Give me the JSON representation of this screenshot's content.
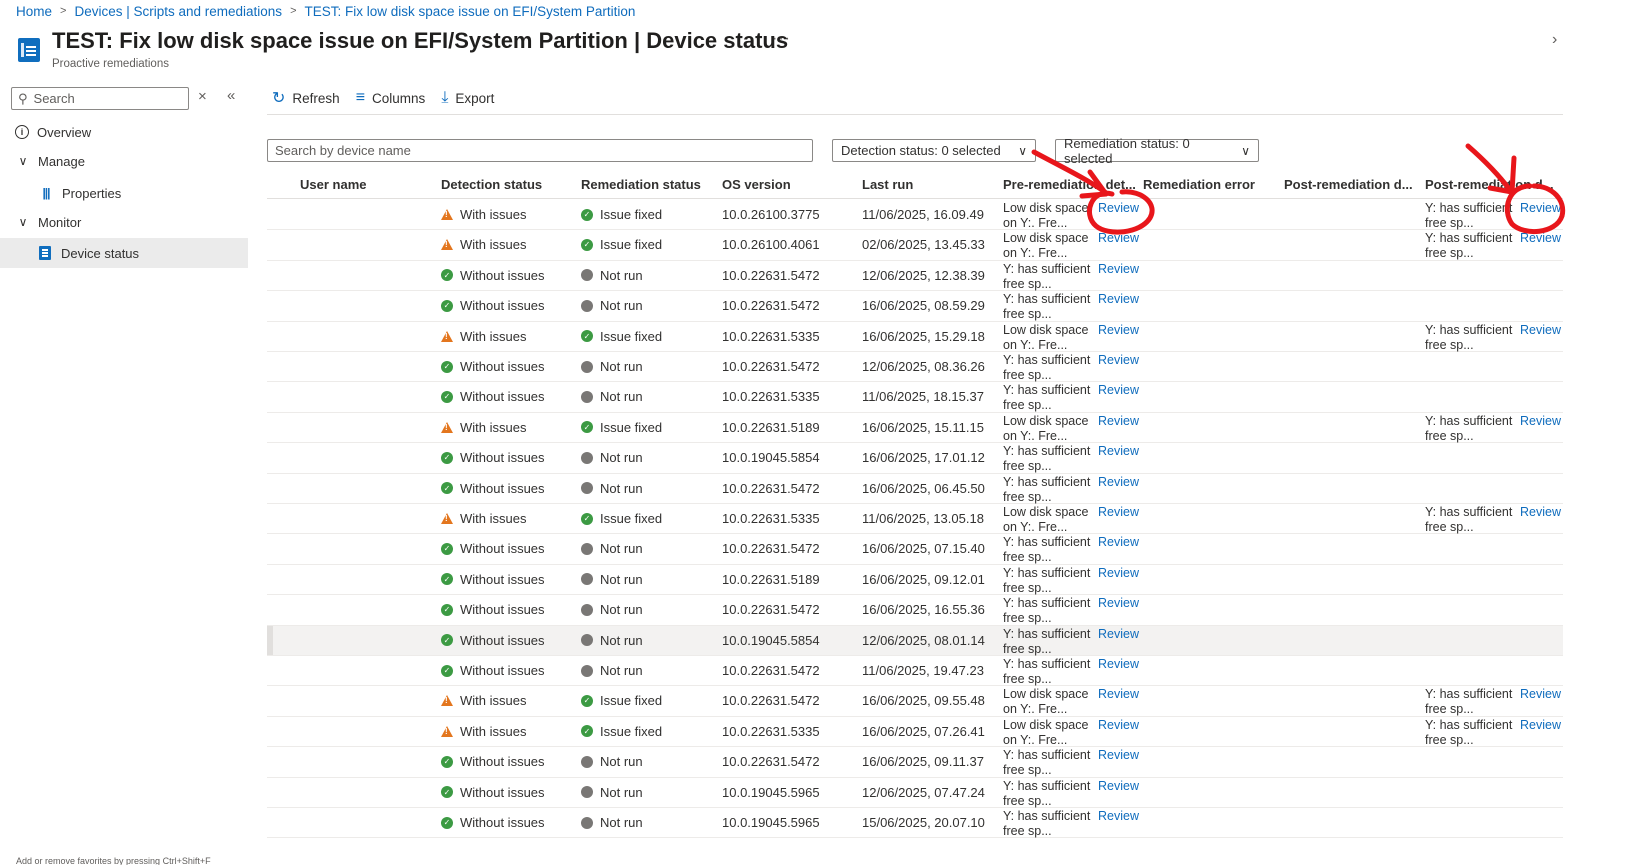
{
  "breadcrumb": {
    "items": [
      "Home",
      "Devices | Scripts and remediations",
      "TEST: Fix low disk space issue on EFI/System Partition"
    ]
  },
  "header": {
    "title": "TEST: Fix low disk space issue on EFI/System Partition",
    "title_suffix": "| Device status",
    "subtitle": "Proactive remediations",
    "more": "···",
    "chevron": "›"
  },
  "sidebar": {
    "search_placeholder": "Search",
    "close": "×",
    "collapse": "«",
    "items": [
      {
        "label": "Overview"
      },
      {
        "label": "Manage"
      },
      {
        "label": "Properties"
      },
      {
        "label": "Monitor"
      },
      {
        "label": "Device status"
      }
    ],
    "footer": "Add or remove favorites by pressing Ctrl+Shift+F"
  },
  "toolbar": {
    "refresh": "Refresh",
    "columns": "Columns",
    "export": "Export"
  },
  "filters": {
    "device_search_placeholder": "Search by device name",
    "detection": "Detection status: 0 selected",
    "remediation": "Remediation status: 0 selected"
  },
  "table": {
    "columns": [
      "User name",
      "Detection status",
      "Remediation status",
      "OS version",
      "Last run",
      "Pre-remediation det...",
      "Remediation error",
      "Post-remediation d...",
      "Post-remediation d..."
    ],
    "review_label": "Review",
    "rows": [
      {
        "det": "With issues",
        "det_type": "warn",
        "rem": "Issue fixed",
        "rem_type": "ok",
        "os": "10.0.26100.3775",
        "last": "11/06/2025, 16.09.49",
        "pre": "Low disk space on Y:. Fre...",
        "post": "Y: has sufficient free sp..."
      },
      {
        "det": "With issues",
        "det_type": "warn",
        "rem": "Issue fixed",
        "rem_type": "ok",
        "os": "10.0.26100.4061",
        "last": "02/06/2025, 13.45.33",
        "pre": "Low disk space on Y:. Fre...",
        "post": "Y: has sufficient free sp..."
      },
      {
        "det": "Without issues",
        "det_type": "ok",
        "rem": "Not run",
        "rem_type": "gray",
        "os": "10.0.22631.5472",
        "last": "12/06/2025, 12.38.39",
        "pre": "Y: has sufficient free sp...",
        "post": ""
      },
      {
        "det": "Without issues",
        "det_type": "ok",
        "rem": "Not run",
        "rem_type": "gray",
        "os": "10.0.22631.5472",
        "last": "16/06/2025, 08.59.29",
        "pre": "Y: has sufficient free sp...",
        "post": ""
      },
      {
        "det": "With issues",
        "det_type": "warn",
        "rem": "Issue fixed",
        "rem_type": "ok",
        "os": "10.0.22631.5335",
        "last": "16/06/2025, 15.29.18",
        "pre": "Low disk space on Y:. Fre...",
        "post": "Y: has sufficient free sp..."
      },
      {
        "det": "Without issues",
        "det_type": "ok",
        "rem": "Not run",
        "rem_type": "gray",
        "os": "10.0.22631.5472",
        "last": "12/06/2025, 08.36.26",
        "pre": "Y: has sufficient free sp...",
        "post": ""
      },
      {
        "det": "Without issues",
        "det_type": "ok",
        "rem": "Not run",
        "rem_type": "gray",
        "os": "10.0.22631.5335",
        "last": "11/06/2025, 18.15.37",
        "pre": "Y: has sufficient free sp...",
        "post": ""
      },
      {
        "det": "With issues",
        "det_type": "warn",
        "rem": "Issue fixed",
        "rem_type": "ok",
        "os": "10.0.22631.5189",
        "last": "16/06/2025, 15.11.15",
        "pre": "Low disk space on Y:. Fre...",
        "post": "Y: has sufficient free sp..."
      },
      {
        "det": "Without issues",
        "det_type": "ok",
        "rem": "Not run",
        "rem_type": "gray",
        "os": "10.0.19045.5854",
        "last": "16/06/2025, 17.01.12",
        "pre": "Y: has sufficient free sp...",
        "post": ""
      },
      {
        "det": "Without issues",
        "det_type": "ok",
        "rem": "Not run",
        "rem_type": "gray",
        "os": "10.0.22631.5472",
        "last": "16/06/2025, 06.45.50",
        "pre": "Y: has sufficient free sp...",
        "post": ""
      },
      {
        "det": "With issues",
        "det_type": "warn",
        "rem": "Issue fixed",
        "rem_type": "ok",
        "os": "10.0.22631.5335",
        "last": "11/06/2025, 13.05.18",
        "pre": "Low disk space on Y:. Fre...",
        "post": "Y: has sufficient free sp..."
      },
      {
        "det": "Without issues",
        "det_type": "ok",
        "rem": "Not run",
        "rem_type": "gray",
        "os": "10.0.22631.5472",
        "last": "16/06/2025, 07.15.40",
        "pre": "Y: has sufficient free sp...",
        "post": ""
      },
      {
        "det": "Without issues",
        "det_type": "ok",
        "rem": "Not run",
        "rem_type": "gray",
        "os": "10.0.22631.5189",
        "last": "16/06/2025, 09.12.01",
        "pre": "Y: has sufficient free sp...",
        "post": ""
      },
      {
        "det": "Without issues",
        "det_type": "ok",
        "rem": "Not run",
        "rem_type": "gray",
        "os": "10.0.22631.5472",
        "last": "16/06/2025, 16.55.36",
        "pre": "Y: has sufficient free sp...",
        "post": ""
      },
      {
        "det": "Without issues",
        "det_type": "ok",
        "rem": "Not run",
        "rem_type": "gray",
        "os": "10.0.19045.5854",
        "last": "12/06/2025, 08.01.14",
        "pre": "Y: has sufficient free sp...",
        "post": "",
        "highlight": true
      },
      {
        "det": "Without issues",
        "det_type": "ok",
        "rem": "Not run",
        "rem_type": "gray",
        "os": "10.0.22631.5472",
        "last": "11/06/2025, 19.47.23",
        "pre": "Y: has sufficient free sp...",
        "post": ""
      },
      {
        "det": "With issues",
        "det_type": "warn",
        "rem": "Issue fixed",
        "rem_type": "ok",
        "os": "10.0.22631.5472",
        "last": "16/06/2025, 09.55.48",
        "pre": "Low disk space on Y:. Fre...",
        "post": "Y: has sufficient free sp..."
      },
      {
        "det": "With issues",
        "det_type": "warn",
        "rem": "Issue fixed",
        "rem_type": "ok",
        "os": "10.0.22631.5335",
        "last": "16/06/2025, 07.26.41",
        "pre": "Low disk space on Y:. Fre...",
        "post": "Y: has sufficient free sp..."
      },
      {
        "det": "Without issues",
        "det_type": "ok",
        "rem": "Not run",
        "rem_type": "gray",
        "os": "10.0.22631.5472",
        "last": "16/06/2025, 09.11.37",
        "pre": "Y: has sufficient free sp...",
        "post": ""
      },
      {
        "det": "Without issues",
        "det_type": "ok",
        "rem": "Not run",
        "rem_type": "gray",
        "os": "10.0.19045.5965",
        "last": "12/06/2025, 07.47.24",
        "pre": "Y: has sufficient free sp...",
        "post": ""
      },
      {
        "det": "Without issues",
        "det_type": "ok",
        "rem": "Not run",
        "rem_type": "gray",
        "os": "10.0.19045.5965",
        "last": "15/06/2025, 20.07.10",
        "pre": "Y: has sufficient free sp...",
        "post": ""
      }
    ]
  },
  "colors": {
    "accent": "#0f6cbd",
    "ok": "#3c9a43",
    "warn": "#e3761e",
    "annotation": "#e8161b"
  }
}
